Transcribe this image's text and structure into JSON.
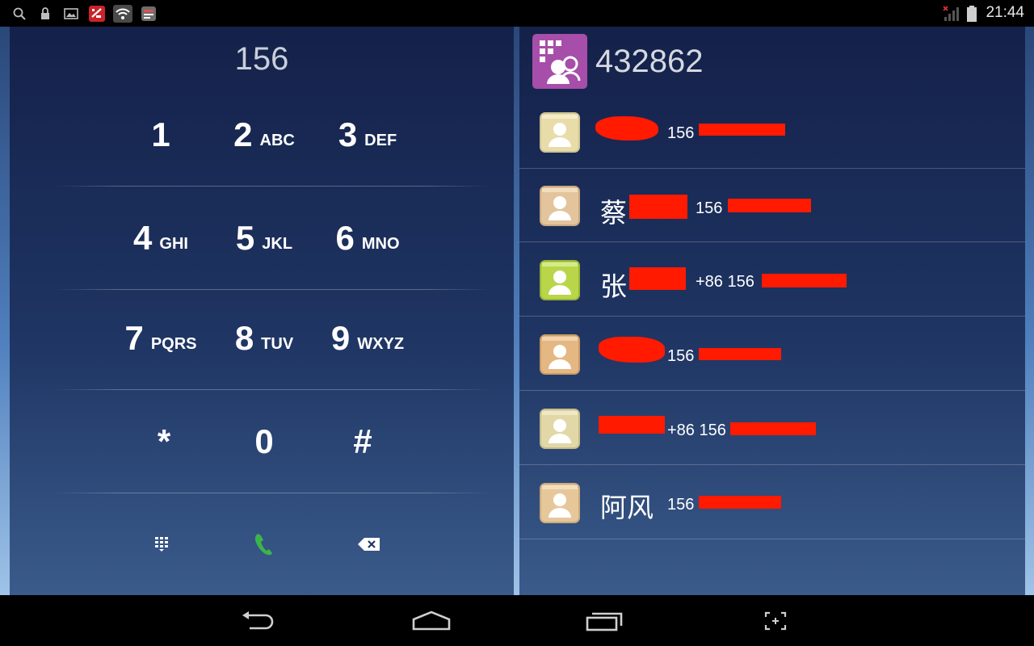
{
  "status_bar": {
    "time": "21:44",
    "left_icons": [
      "search-icon",
      "lock-icon",
      "image-icon",
      "app-notification-icon",
      "wifi-icon",
      "app-icon"
    ],
    "right_icons": [
      "signal-icon",
      "battery-icon"
    ]
  },
  "dialer": {
    "digits": "156",
    "keys": [
      [
        {
          "num": "1",
          "letters": ""
        },
        {
          "num": "2",
          "letters": "ABC"
        },
        {
          "num": "3",
          "letters": "DEF"
        }
      ],
      [
        {
          "num": "4",
          "letters": "GHI"
        },
        {
          "num": "5",
          "letters": "JKL"
        },
        {
          "num": "6",
          "letters": "MNO"
        }
      ],
      [
        {
          "num": "7",
          "letters": "PQRS"
        },
        {
          "num": "8",
          "letters": "TUV"
        },
        {
          "num": "9",
          "letters": "WXYZ"
        }
      ],
      [
        {
          "num": "*",
          "letters": ""
        },
        {
          "num": "0",
          "letters": ""
        },
        {
          "num": "#",
          "letters": ""
        }
      ]
    ],
    "bottom_actions": [
      "keypad-toggle-icon",
      "call-icon",
      "backspace-icon"
    ],
    "call_color": "#3cb44b"
  },
  "results": {
    "query": "432862",
    "app_logo_color": "#a64ea9",
    "contacts": [
      {
        "name": "",
        "number": "156",
        "avatar_color": "#e8dca8"
      },
      {
        "name": "蔡",
        "number": "156",
        "avatar_color": "#e3c49c"
      },
      {
        "name": "张",
        "number": "+86 156",
        "avatar_color": "#b9d64a"
      },
      {
        "name": "",
        "number": "156",
        "avatar_color": "#e5b783"
      },
      {
        "name": "",
        "number": "+86 156",
        "avatar_color": "#e2d7a6"
      },
      {
        "name": "阿风",
        "number": "156",
        "avatar_color": "#e6c79a"
      }
    ]
  },
  "nav_bar": {
    "buttons": [
      "back-icon",
      "home-icon",
      "recent-apps-icon",
      "screenshot-icon"
    ]
  },
  "colors": {
    "redaction": "#ff1a00"
  }
}
